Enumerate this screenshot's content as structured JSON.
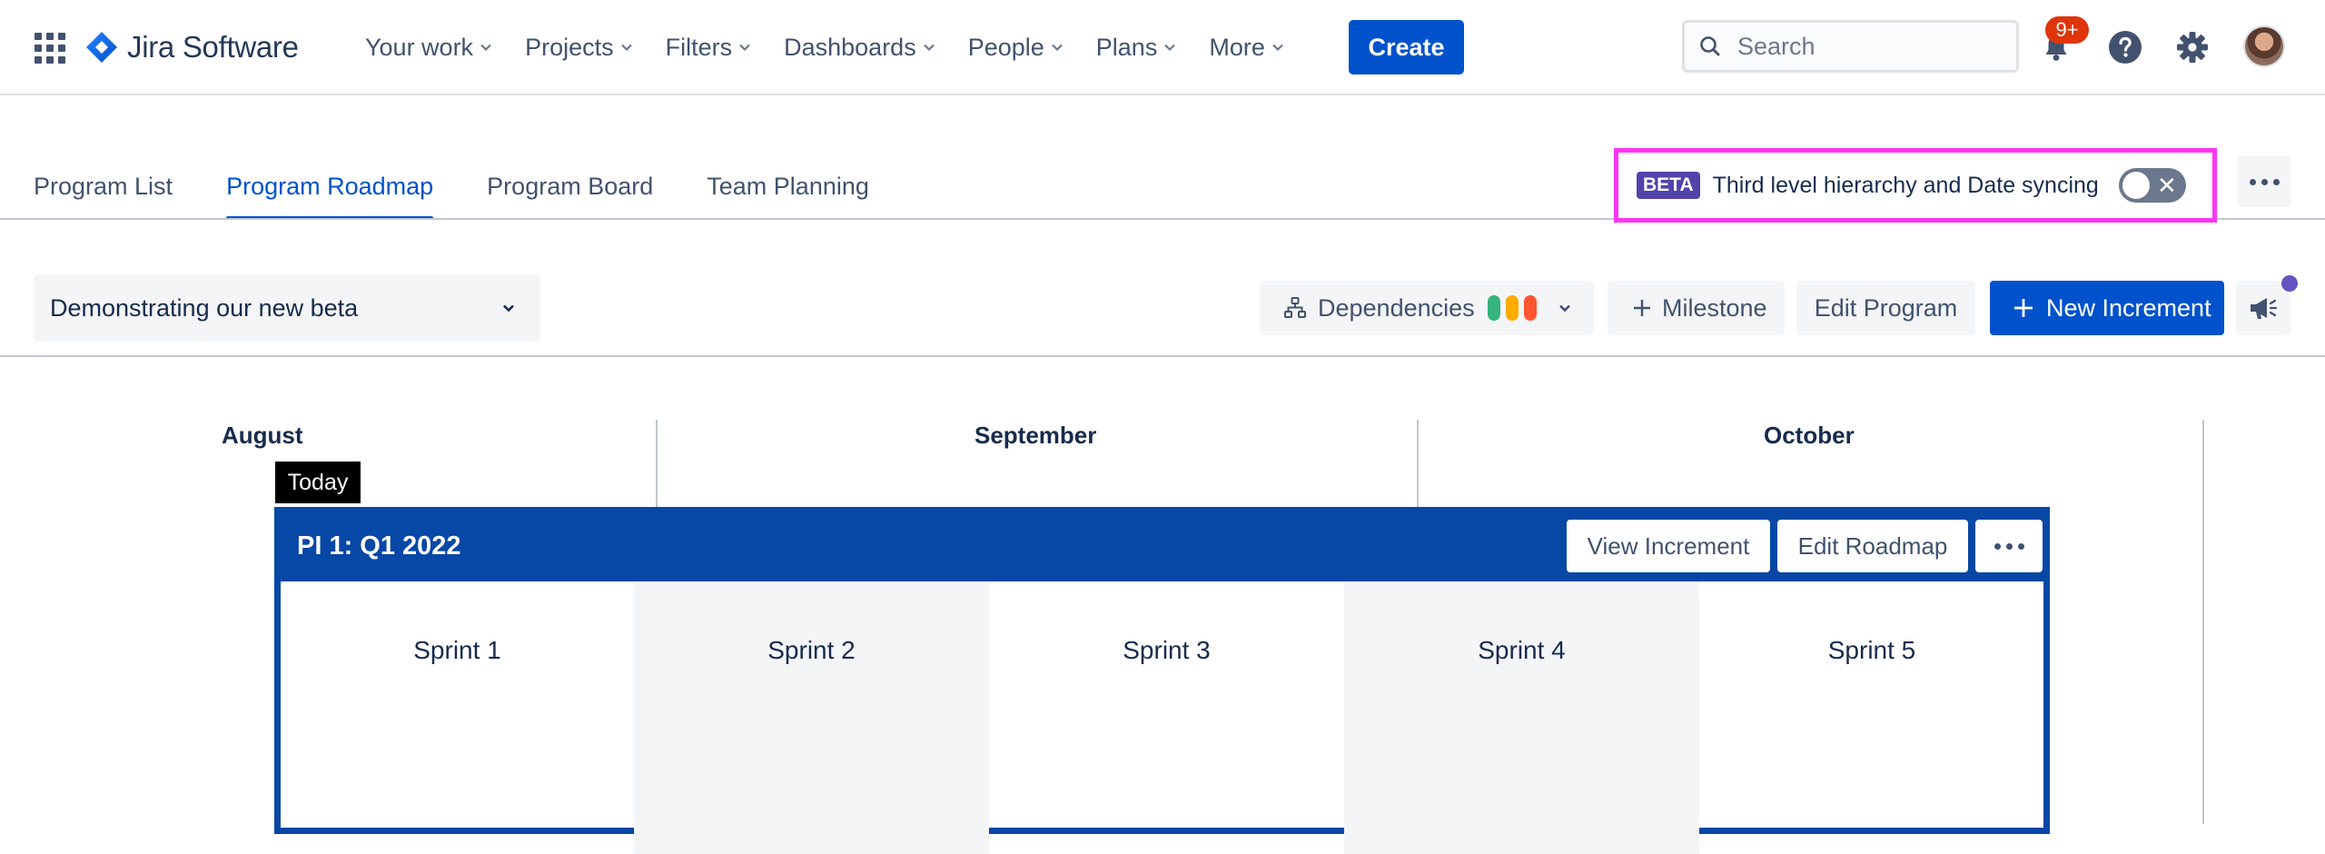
{
  "nav": {
    "product_name": "Jira Software",
    "items": [
      {
        "label": "Your work"
      },
      {
        "label": "Projects"
      },
      {
        "label": "Filters"
      },
      {
        "label": "Dashboards"
      },
      {
        "label": "People"
      },
      {
        "label": "Plans"
      },
      {
        "label": "More"
      }
    ],
    "create_label": "Create",
    "search_placeholder": "Search",
    "notifications_badge": "9+"
  },
  "tabs": [
    {
      "label": "Program List",
      "active": false
    },
    {
      "label": "Program Roadmap",
      "active": true
    },
    {
      "label": "Program Board",
      "active": false
    },
    {
      "label": "Team Planning",
      "active": false
    }
  ],
  "beta": {
    "badge": "BETA",
    "text": "Third level hierarchy and Date syncing",
    "toggle_on": false
  },
  "toolbar": {
    "program_selected": "Demonstrating our new beta",
    "dependencies_label": "Dependencies",
    "dependency_colors": [
      "#36B37E",
      "#FFAB00",
      "#FF5630"
    ],
    "milestone_label": "Milestone",
    "edit_program_label": "Edit Program",
    "new_increment_label": "New Increment"
  },
  "roadmap": {
    "months": [
      "August",
      "September",
      "October"
    ],
    "today_label": "Today",
    "increment": {
      "title": "PI 1: Q1 2022",
      "view_label": "View Increment",
      "edit_label": "Edit Roadmap"
    },
    "sprints": [
      "Sprint 1",
      "Sprint 2",
      "Sprint 3",
      "Sprint 4",
      "Sprint 5"
    ]
  },
  "colors": {
    "primary": "#0052CC",
    "increment_blue": "#0747A6",
    "beta_purple": "#5243AA",
    "highlight_magenta": "#FF35F5",
    "badge_red": "#DE350B"
  }
}
